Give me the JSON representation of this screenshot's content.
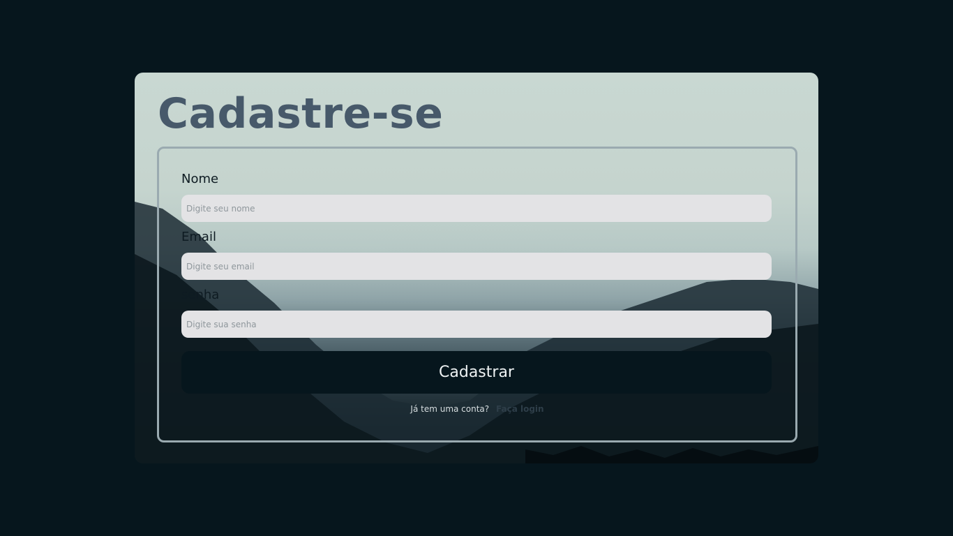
{
  "page": {
    "title": "Cadastre-se"
  },
  "form": {
    "name_label": "Nome",
    "name_placeholder": "Digite seu nome",
    "email_label": "Email",
    "email_placeholder": "Digite seu email",
    "password_label": "senha",
    "password_placeholder": "Digite sua senha",
    "submit_label": "Cadastrar"
  },
  "footer": {
    "prompt": "Já tem uma conta?",
    "login_link": "Faça login"
  },
  "colors": {
    "background": "#06161d",
    "title": "#47596a",
    "button": "#06161d",
    "input": "#e3e3e5"
  }
}
